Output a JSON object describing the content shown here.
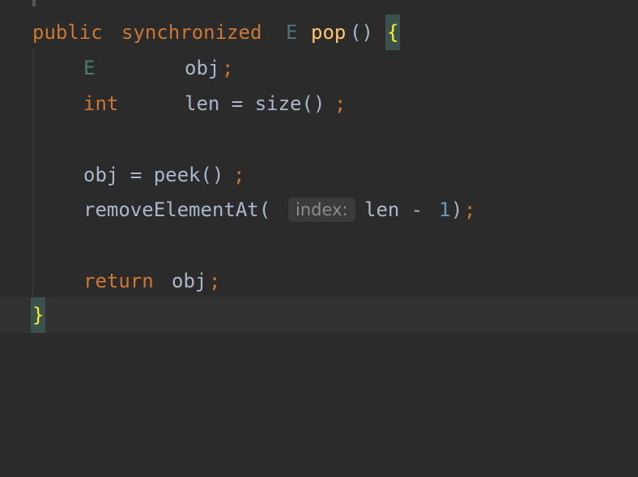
{
  "code": {
    "line1": {
      "kw_public": "public",
      "kw_synchronized": "synchronized",
      "type_E": "E",
      "method": "pop",
      "parens": "()",
      "open_brace": "{"
    },
    "line2": {
      "type": "E",
      "name": "obj",
      "semi": ";"
    },
    "line3": {
      "type": "int",
      "expr": "len = size()",
      "semi": ";"
    },
    "line4": {
      "expr": "obj = peek()",
      "semi": ";"
    },
    "line5": {
      "call": "removeElementAt(",
      "hint": "index:",
      "arg": "len - ",
      "num": "1",
      "close": ")",
      "semi": ";"
    },
    "line6": {
      "kw": "return",
      "value": "obj",
      "semi": ";"
    },
    "line7": {
      "close_brace": "}"
    }
  },
  "colors": {
    "background": "#2b2b2b",
    "keyword": "#cc7832",
    "type": "#507874",
    "method": "#ffc66d",
    "text": "#a9b7c6",
    "number": "#6897bb",
    "brace_match": "#ffef28"
  }
}
